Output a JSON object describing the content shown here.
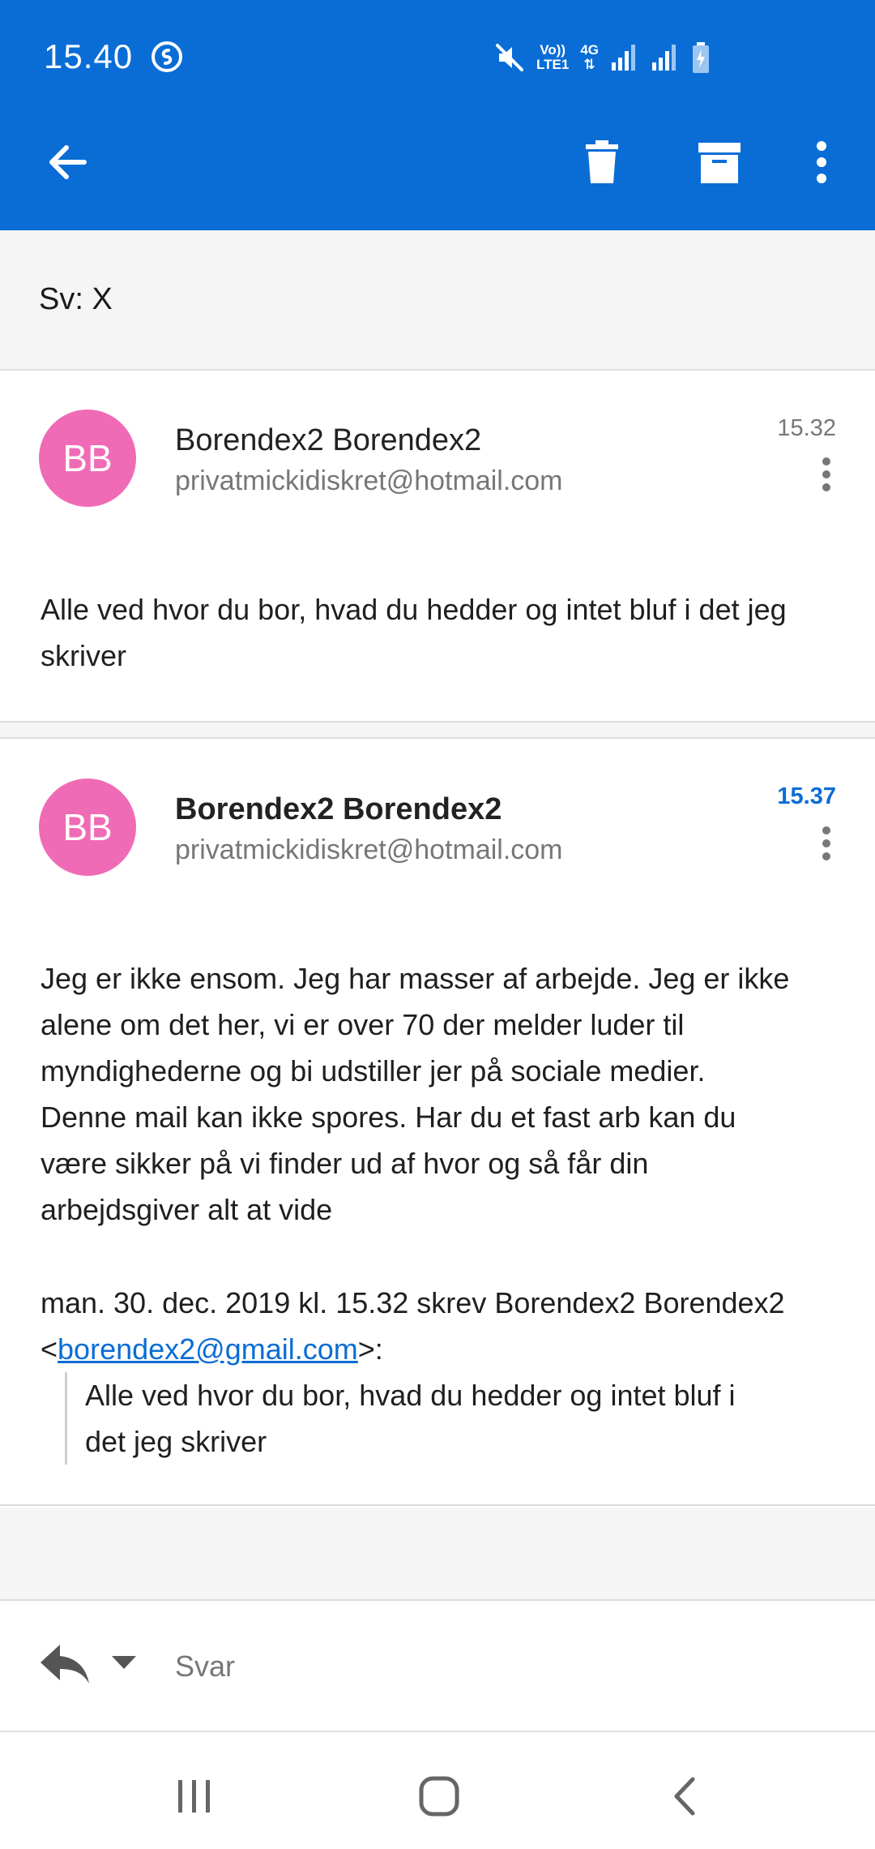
{
  "status_bar": {
    "time": "15.40",
    "network_top": "Vo))",
    "network_bottom": "LTE1",
    "data_type": "4G",
    "icons": [
      "shazam-icon",
      "mute-icon",
      "signal-icon",
      "battery-charging-icon"
    ]
  },
  "toolbar": {
    "icons": [
      "back-arrow-icon",
      "delete-icon",
      "archive-icon",
      "more-vert-icon"
    ],
    "color": "#0a6dd6"
  },
  "subject": "Sv: X",
  "messages": [
    {
      "avatar_initials": "BB",
      "sender_name": "Borendex2 Borendex2",
      "sender_email": "privatmickidiskret@hotmail.com",
      "time": "15.32",
      "body": "Alle ved hvor du bor, hvad du hedder og intet bluf i det jeg skriver"
    },
    {
      "avatar_initials": "BB",
      "sender_name": "Borendex2 Borendex2",
      "sender_email": "privatmickidiskret@hotmail.com",
      "time": "15.37",
      "body_lines": [
        "Jeg er ikke ensom. Jeg har masser af arbejde. Jeg er ikke",
        "alene om det her, vi er over 70 der melder luder til",
        "myndighederne og bi udstiller jer på sociale medier.",
        "Denne mail kan ikke spores. Har du et fast arb kan du",
        "være sikker på vi finder ud af hvor og så får din",
        "arbejdsgiver alt at vide"
      ],
      "quote_header": "man. 30. dec. 2019 kl. 15.32 skrev Borendex2 Borendex2",
      "quote_email_prefix": "<",
      "quote_email": "borendex2@gmail.com",
      "quote_email_suffix": ">:",
      "quote_lines": [
        "Alle ved hvor du bor, hvad du hedder og intet bluf i",
        "det jeg skriver"
      ]
    }
  ],
  "reply": {
    "label": "Svar"
  },
  "colors": {
    "accent": "#0a6dd6",
    "avatar": "#f06bb5"
  }
}
